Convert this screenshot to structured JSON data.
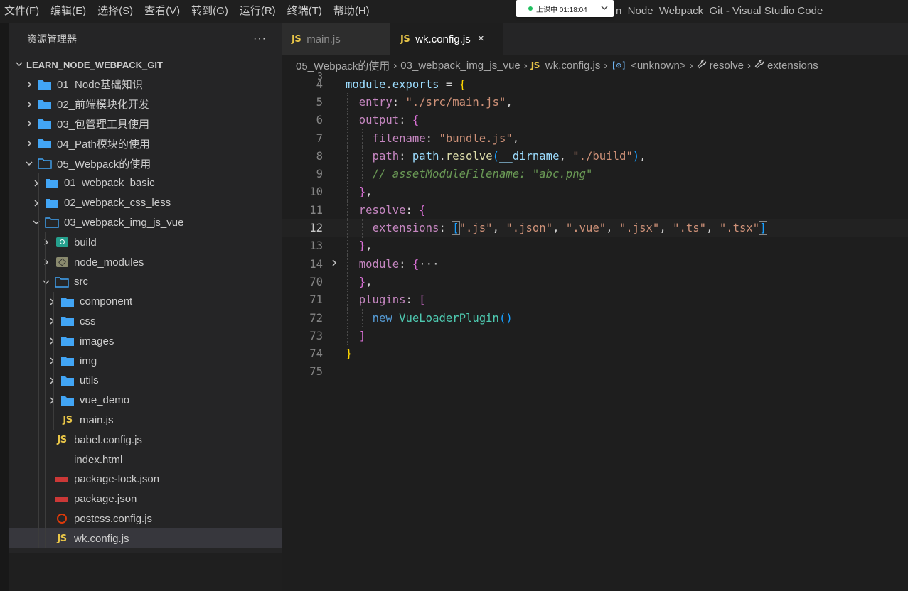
{
  "menu": [
    "文件(F)",
    "编辑(E)",
    "选择(S)",
    "查看(V)",
    "转到(G)",
    "运行(R)",
    "终端(T)",
    "帮助(H)"
  ],
  "window_title": "n_Node_Webpack_Git - Visual Studio Code",
  "recording": {
    "text": "上课中 01:18:04",
    "chevron": "chevron-down-icon"
  },
  "sidebar": {
    "title": "资源管理器",
    "more": "···",
    "section": "LEARN_NODE_WEBPACK_GIT",
    "tree": [
      {
        "label": "01_Node基础知识",
        "depth": 0,
        "kind": "folder",
        "state": "collapsed"
      },
      {
        "label": "02_前端模块化开发",
        "depth": 0,
        "kind": "folder",
        "state": "collapsed"
      },
      {
        "label": "03_包管理工具使用",
        "depth": 0,
        "kind": "folder",
        "state": "collapsed"
      },
      {
        "label": "04_Path模块的使用",
        "depth": 0,
        "kind": "folder",
        "state": "collapsed"
      },
      {
        "label": "05_Webpack的使用",
        "depth": 0,
        "kind": "folder-open",
        "state": "expanded"
      },
      {
        "label": "01_webpack_basic",
        "depth": 1,
        "kind": "folder",
        "state": "collapsed"
      },
      {
        "label": "02_webpack_css_less",
        "depth": 1,
        "kind": "folder",
        "state": "collapsed"
      },
      {
        "label": "03_webpack_img_js_vue",
        "depth": 1,
        "kind": "folder-open",
        "state": "expanded"
      },
      {
        "label": "build",
        "depth": 2,
        "kind": "build",
        "state": "collapsed"
      },
      {
        "label": "node_modules",
        "depth": 2,
        "kind": "node_modules",
        "state": "collapsed"
      },
      {
        "label": "src",
        "depth": 2,
        "kind": "folder-open",
        "state": "expanded"
      },
      {
        "label": "component",
        "depth": 3,
        "kind": "folder",
        "state": "collapsed"
      },
      {
        "label": "css",
        "depth": 3,
        "kind": "folder",
        "state": "collapsed"
      },
      {
        "label": "images",
        "depth": 3,
        "kind": "folder",
        "state": "collapsed"
      },
      {
        "label": "img",
        "depth": 3,
        "kind": "folder",
        "state": "collapsed"
      },
      {
        "label": "utils",
        "depth": 3,
        "kind": "folder",
        "state": "collapsed"
      },
      {
        "label": "vue_demo",
        "depth": 3,
        "kind": "folder",
        "state": "collapsed"
      },
      {
        "label": "main.js",
        "depth": 3,
        "kind": "js",
        "state": "file"
      },
      {
        "label": "babel.config.js",
        "depth": 2,
        "kind": "js",
        "state": "file"
      },
      {
        "label": "index.html",
        "depth": 2,
        "kind": "html",
        "state": "file"
      },
      {
        "label": "package-lock.json",
        "depth": 2,
        "kind": "npm",
        "state": "file"
      },
      {
        "label": "package.json",
        "depth": 2,
        "kind": "npm",
        "state": "file"
      },
      {
        "label": "postcss.config.js",
        "depth": 2,
        "kind": "postcss",
        "state": "file"
      },
      {
        "label": "wk.config.js",
        "depth": 2,
        "kind": "js",
        "state": "file",
        "selected": true
      }
    ]
  },
  "icons": {
    "js_badge": "JS",
    "html_badge": "</>",
    "fold_ellipsis": "···"
  },
  "tabs": [
    {
      "label": "main.js",
      "active": false
    },
    {
      "label": "wk.config.js",
      "active": true,
      "close": "×"
    }
  ],
  "breadcrumb": {
    "folder1": "05_Webpack的使用",
    "folder2": "03_webpack_img_js_vue",
    "file": "wk.config.js",
    "symbol1": "<unknown>",
    "symbol2": "resolve",
    "symbol3": "extensions"
  },
  "code": {
    "partial_line_number": "3",
    "active_line": "12",
    "lines": [
      {
        "n": "4",
        "indent": 0,
        "tokens": [
          [
            "k-var",
            "module"
          ],
          [
            "k-op",
            "."
          ],
          [
            "k-var",
            "exports"
          ],
          [
            "k-op",
            " = "
          ],
          [
            "k-brk1",
            "{"
          ]
        ]
      },
      {
        "n": "5",
        "indent": 1,
        "tokens": [
          [
            "k-prop",
            "entry"
          ],
          [
            "k-op",
            ": "
          ],
          [
            "k-str",
            "\"./src/main.js\""
          ],
          [
            "k-op",
            ","
          ]
        ]
      },
      {
        "n": "6",
        "indent": 1,
        "tokens": [
          [
            "k-prop",
            "output"
          ],
          [
            "k-op",
            ": "
          ],
          [
            "k-brk2",
            "{"
          ]
        ]
      },
      {
        "n": "7",
        "indent": 2,
        "tokens": [
          [
            "k-prop",
            "filename"
          ],
          [
            "k-op",
            ": "
          ],
          [
            "k-str",
            "\"bundle.js\""
          ],
          [
            "k-op",
            ","
          ]
        ]
      },
      {
        "n": "8",
        "indent": 2,
        "tokens": [
          [
            "k-prop",
            "path"
          ],
          [
            "k-op",
            ": "
          ],
          [
            "k-var",
            "path"
          ],
          [
            "k-op",
            "."
          ],
          [
            "k-fn",
            "resolve"
          ],
          [
            "k-brk3",
            "("
          ],
          [
            "k-var",
            "__dirname"
          ],
          [
            "k-op",
            ", "
          ],
          [
            "k-str",
            "\"./build\""
          ],
          [
            "k-brk3",
            ")"
          ],
          [
            "k-op",
            ","
          ]
        ]
      },
      {
        "n": "9",
        "indent": 2,
        "tokens": [
          [
            "k-cmt",
            "// assetModuleFilename: \"abc.png\""
          ]
        ]
      },
      {
        "n": "10",
        "indent": 1,
        "tokens": [
          [
            "k-brk2",
            "}"
          ],
          [
            "k-op",
            ","
          ]
        ]
      },
      {
        "n": "11",
        "indent": 1,
        "tokens": [
          [
            "k-prop",
            "resolve"
          ],
          [
            "k-op",
            ": "
          ],
          [
            "k-brk2",
            "{"
          ]
        ]
      },
      {
        "n": "12",
        "indent": 2,
        "current": true,
        "tokens": [
          [
            "k-prop",
            "extensions"
          ],
          [
            "k-op",
            ": "
          ],
          [
            "k-brk3 bracket-box",
            "["
          ],
          [
            "k-str",
            "\".js\""
          ],
          [
            "k-op",
            ", "
          ],
          [
            "k-str",
            "\".json\""
          ],
          [
            "k-op",
            ", "
          ],
          [
            "k-str",
            "\".vue\""
          ],
          [
            "k-op",
            ", "
          ],
          [
            "k-str",
            "\".jsx\""
          ],
          [
            "k-op",
            ", "
          ],
          [
            "k-str",
            "\".ts\""
          ],
          [
            "k-op",
            ", "
          ],
          [
            "k-str",
            "\".tsx\""
          ],
          [
            "k-brk3 bracket-box",
            "]"
          ]
        ]
      },
      {
        "n": "13",
        "indent": 1,
        "tokens": [
          [
            "k-brk2",
            "}"
          ],
          [
            "k-op",
            ","
          ]
        ]
      },
      {
        "n": "14",
        "indent": 1,
        "fold": "›",
        "tokens": [
          [
            "k-prop",
            "module"
          ],
          [
            "k-op",
            ": "
          ],
          [
            "k-brk2",
            "{"
          ],
          [
            "k-ellipsis",
            "···"
          ]
        ]
      },
      {
        "n": "70",
        "indent": 1,
        "tokens": [
          [
            "k-brk2",
            "}"
          ],
          [
            "k-op",
            ","
          ]
        ]
      },
      {
        "n": "71",
        "indent": 1,
        "tokens": [
          [
            "k-prop",
            "plugins"
          ],
          [
            "k-op",
            ": "
          ],
          [
            "k-brk2",
            "["
          ]
        ]
      },
      {
        "n": "72",
        "indent": 2,
        "tokens": [
          [
            "k-kw",
            "new"
          ],
          [
            "k-op",
            " "
          ],
          [
            "k-cls",
            "VueLoaderPlugin"
          ],
          [
            "k-brk3",
            "()"
          ]
        ]
      },
      {
        "n": "73",
        "indent": 1,
        "tokens": [
          [
            "k-brk2",
            "]"
          ]
        ]
      },
      {
        "n": "74",
        "indent": 0,
        "tokens": [
          [
            "k-brk1",
            "}"
          ]
        ]
      },
      {
        "n": "75",
        "indent": 0,
        "tokens": []
      }
    ]
  }
}
